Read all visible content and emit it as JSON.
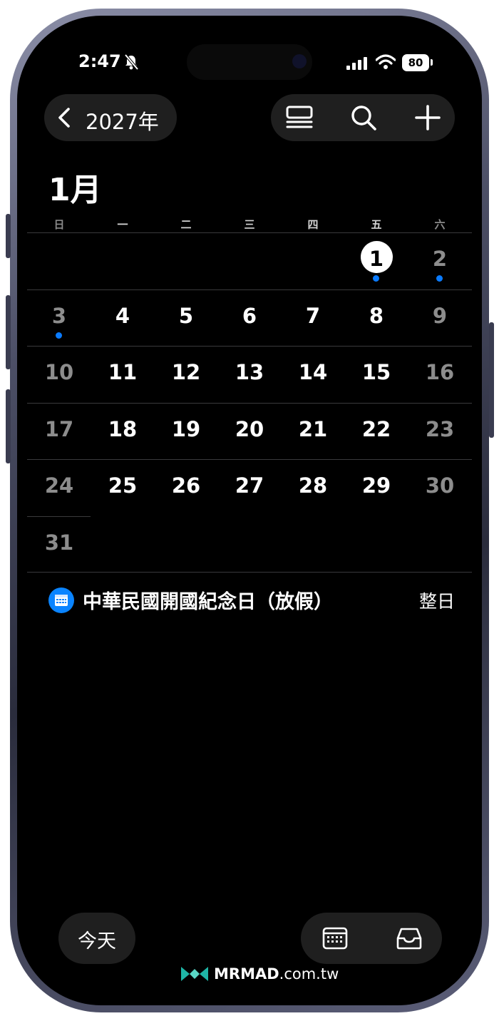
{
  "status_bar": {
    "time": "2:47",
    "battery": "80"
  },
  "header": {
    "back_label": "2027年"
  },
  "month": {
    "title": "1月",
    "weekdays": [
      "日",
      "一",
      "二",
      "三",
      "四",
      "五",
      "六"
    ],
    "days": [
      "1",
      "2",
      "3",
      "4",
      "5",
      "6",
      "7",
      "8",
      "9",
      "10",
      "11",
      "12",
      "13",
      "14",
      "15",
      "16",
      "17",
      "18",
      "19",
      "20",
      "21",
      "22",
      "23",
      "24",
      "25",
      "26",
      "27",
      "28",
      "29",
      "30",
      "31"
    ],
    "today": "1",
    "days_with_events": [
      "1",
      "2",
      "3"
    ]
  },
  "event": {
    "title": "中華民國開國紀念日（放假）",
    "time": "整日"
  },
  "bottom": {
    "today_label": "今天"
  },
  "watermark": {
    "brand": "MRMAD",
    "domain": ".com.tw"
  },
  "colors": {
    "accent": "#0a84ff",
    "event_dot": "#0a7bff",
    "background": "#000000"
  }
}
